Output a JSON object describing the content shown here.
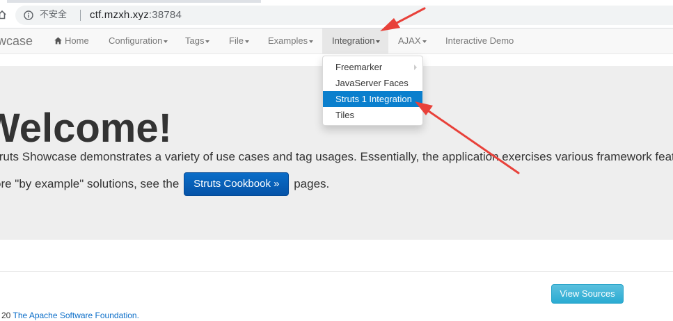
{
  "browser": {
    "insecure_label": "不安全",
    "url_host": "ctf.mzxh.xyz",
    "url_port": ":38784"
  },
  "navbar": {
    "brand": "wcase",
    "items": [
      {
        "label": "Home",
        "icon": "home-icon"
      },
      {
        "label": "Configuration",
        "dropdown": true
      },
      {
        "label": "Tags",
        "dropdown": true
      },
      {
        "label": "File",
        "dropdown": true
      },
      {
        "label": "Examples",
        "dropdown": true
      },
      {
        "label": "Integration",
        "dropdown": true,
        "active": true
      },
      {
        "label": "AJAX",
        "dropdown": true
      },
      {
        "label": "Interactive Demo"
      }
    ]
  },
  "integration_menu": {
    "items": [
      {
        "label": "Freemarker",
        "submenu": true
      },
      {
        "label": "JavaServer Faces"
      },
      {
        "label": "Struts 1 Integration",
        "selected": true
      },
      {
        "label": "Tiles"
      }
    ]
  },
  "jumbotron": {
    "heading": "Welcome!",
    "lead1": "truts Showcase demonstrates a variety of use cases and tag usages. Essentially, the application exercises various framework features i",
    "lead2_before": "ore \"by example\" solutions, see the",
    "cookbook_button": "Struts Cookbook »",
    "lead2_after": "pages."
  },
  "footer": {
    "view_sources_button": "View Sources",
    "copyright_prefix": "20",
    "foundation_link": "The Apache Software Foundation."
  },
  "colors": {
    "annotation_arrow": "#e8413a",
    "selected_item": "#0a7fcd",
    "primary_button": "#0560b8",
    "info_button": "#5bc0de"
  }
}
